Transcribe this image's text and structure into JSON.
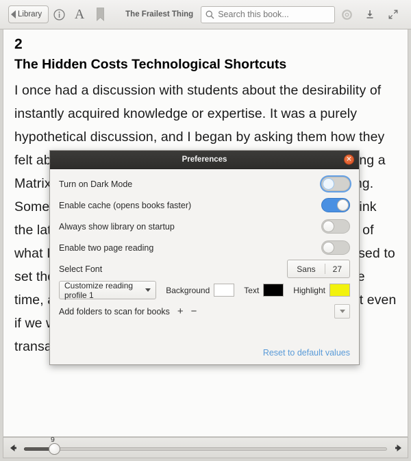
{
  "toolbar": {
    "back_label": "Library",
    "info_icon": "info-icon",
    "font_icon": "font-A-icon",
    "bookmark_icon": "bookmark-icon",
    "book_title": "The Frailest Thing",
    "search_placeholder": "Search this book...",
    "search_value": "",
    "search_icon": "search-icon",
    "gear_icon": "gear-icon",
    "download_icon": "download-icon",
    "fullscreen_icon": "fullscreen-icon",
    "close_icon": "close-icon"
  },
  "reader": {
    "chapter_number": "2",
    "chapter_title": "The Hidden Costs Technological Shortcuts",
    "paragraph": "I once had a discussion with students about the desirability of instantly acquired knowledge or expertise. It was a purely hypothetical discussion, and I began by asking them how they felt about it. Some of them immediately thought about taking a Matrix-like approach; they believed it would be a good thing. Some of the students of a bit more skeptical, although I think the latter took that position, in part, because it the reverse of what I was thinking (and so they thought they were supposed to set those positions). My argument was my argument at the time, and the one I’d like to briefly articulate here, was that even if we were able to acquire knowledge through such a transaction, we should not really want to."
  },
  "slider": {
    "value": "9",
    "left_arrow_icon": "arrow-left-icon",
    "right_arrow_icon": "arrow-right-icon"
  },
  "dialog": {
    "title": "Preferences",
    "close_icon": "close-icon",
    "rows": {
      "dark_mode": {
        "label": "Turn on Dark Mode",
        "state": "off"
      },
      "cache": {
        "label": "Enable cache (opens books faster)",
        "state": "on"
      },
      "library_startup": {
        "label": "Always show library on startup",
        "state": "off"
      },
      "two_page": {
        "label": "Enable two page reading",
        "state": "off"
      },
      "select_font": {
        "label": "Select Font",
        "font_name": "Sans",
        "font_size": "27"
      },
      "profile": {
        "label": "Customize reading profile 1"
      },
      "colors": {
        "background_label": "Background",
        "background_color": "#ffffff",
        "text_label": "Text",
        "text_color": "#000000",
        "highlight_label": "Highlight",
        "highlight_color": "#f2f20d"
      },
      "folders": {
        "label": "Add folders to scan for books",
        "add": "+",
        "remove": "−"
      }
    },
    "reset_link": "Reset to default values"
  }
}
